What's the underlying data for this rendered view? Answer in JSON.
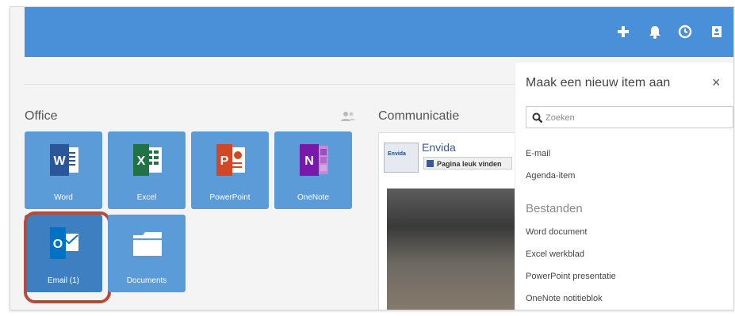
{
  "topbar": {
    "icons": [
      "plus-icon",
      "bell-icon",
      "clock-icon",
      "contact-card-icon"
    ],
    "color": "#4a90d9"
  },
  "office": {
    "title": "Office",
    "tiles": [
      {
        "label": "Word",
        "letter": "W",
        "color": "#2b579a"
      },
      {
        "label": "Excel",
        "letter": "X",
        "color": "#217346"
      },
      {
        "label": "PowerPoint",
        "letter": "P",
        "color": "#d24726"
      },
      {
        "label": "OneNote",
        "letter": "N",
        "color": "#7719aa"
      },
      {
        "label": "Email (1)",
        "letter": "O",
        "color": "#0072c6"
      },
      {
        "label": "Documents",
        "letter": "",
        "color": "#ffffff"
      }
    ]
  },
  "communicatie": {
    "title": "Communicatie",
    "facebook": {
      "page_name": "Envida",
      "logo_text": "Envida",
      "like_label": "Pagina leuk vinden"
    }
  },
  "new_item_panel": {
    "title": "Maak een nieuw item aan",
    "close": "×",
    "search_placeholder": "Zoeken",
    "items": [
      "E-mail",
      "Agenda-item"
    ],
    "files_heading": "Bestanden",
    "file_items": [
      "Word document",
      "Excel werkblad",
      "PowerPoint presentatie",
      "OneNote notitieblok"
    ]
  },
  "colors": {
    "tile_bg": "#5a9bd8",
    "highlight": "#b84a3a"
  }
}
